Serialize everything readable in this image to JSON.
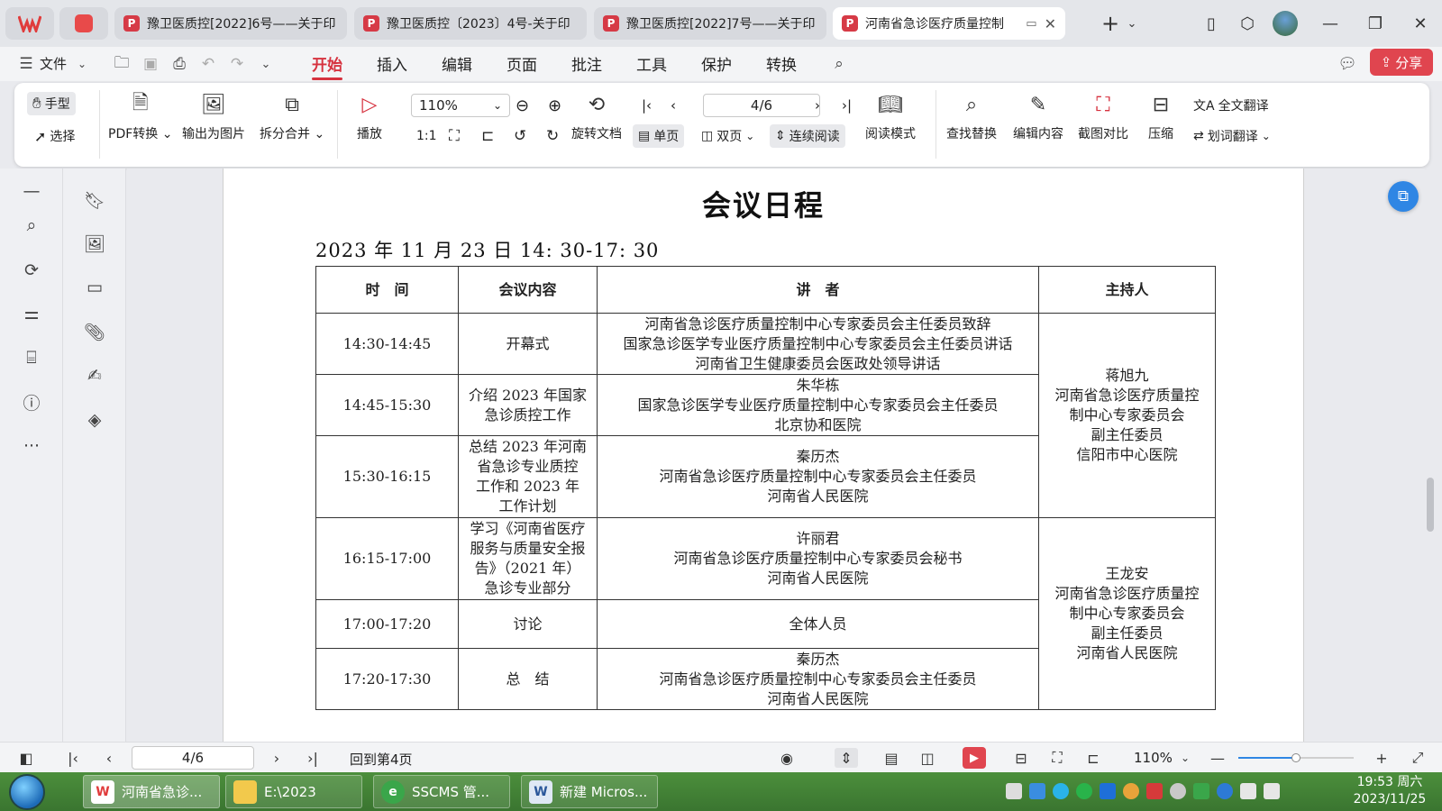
{
  "tabs": [
    {
      "title": "豫卫医质控[2022]6号——关于印"
    },
    {
      "title": "豫卫医质控〔2023〕4号-关于印"
    },
    {
      "title": "豫卫医质控[2022]7号——关于印"
    },
    {
      "title": "河南省急诊医疗质量控制"
    }
  ],
  "menu": {
    "file": "文件",
    "items": [
      "开始",
      "插入",
      "编辑",
      "页面",
      "批注",
      "工具",
      "保护",
      "转换"
    ],
    "share": "分享"
  },
  "ribbon": {
    "hand": "手型",
    "select": "选择",
    "pdf_convert": "PDF转换",
    "export_image": "输出为图片",
    "split_merge": "拆分合并",
    "play": "播放",
    "zoom": "110%",
    "page": "4/6",
    "rotate": "旋转文档",
    "single": "单页",
    "double": "双页",
    "continuous": "连续阅读",
    "reading": "阅读模式",
    "find_replace": "查找替换",
    "edit_content": "编辑内容",
    "screenshot_compare": "截图对比",
    "compress": "压缩",
    "full_translate": "全文翻译",
    "word_translate": "划词翻译"
  },
  "document": {
    "title": "会议日程",
    "date": "2023 年 11 月 23 日 14: 30-17: 30",
    "headers": [
      "时　间",
      "会议内容",
      "讲　者",
      "主持人"
    ],
    "rows": [
      {
        "time": "14:30-14:45",
        "content": [
          "开幕式"
        ],
        "speaker": [
          "河南省急诊医疗质量控制中心专家委员会主任委员致辞",
          "国家急诊医学专业医疗质量控制中心专家委员会主任委员讲话",
          "河南省卫生健康委员会医政处领导讲话"
        ]
      },
      {
        "time": "14:45-15:30",
        "content": [
          "介绍 2023 年国家",
          "急诊质控工作"
        ],
        "speaker": [
          "朱华栋",
          "国家急诊医学专业医疗质量控制中心专家委员会主任委员",
          "北京协和医院"
        ]
      },
      {
        "time": "15:30-16:15",
        "content": [
          "总结 2023 年河南",
          "省急诊专业质控",
          "工作和 2023 年",
          "工作计划"
        ],
        "speaker": [
          "秦历杰",
          "河南省急诊医疗质量控制中心专家委员会主任委员",
          "河南省人民医院"
        ]
      },
      {
        "time": "16:15-17:00",
        "content": [
          "学习《河南省医疗",
          "服务与质量安全报",
          "告》（2021 年）",
          "急诊专业部分"
        ],
        "speaker": [
          "许丽君",
          "河南省急诊医疗质量控制中心专家委员会秘书",
          "河南省人民医院"
        ]
      },
      {
        "time": "17:00-17:20",
        "content": [
          "讨论"
        ],
        "speaker": [
          "全体人员"
        ]
      },
      {
        "time": "17:20-17:30",
        "content": [
          "总　结"
        ],
        "speaker": [
          "秦历杰",
          "河南省急诊医疗质量控制中心专家委员会主任委员",
          "河南省人民医院"
        ]
      }
    ],
    "hosts": [
      {
        "lines": [
          "蒋旭九",
          "河南省急诊医疗质量控",
          "制中心专家委员会",
          "副主任委员",
          "信阳市中心医院"
        ]
      },
      {
        "lines": [
          "王龙安",
          "河南省急诊医疗质量控",
          "制中心专家委员会",
          "副主任委员",
          "河南省人民医院"
        ]
      }
    ]
  },
  "statusbar": {
    "page": "4/6",
    "back_to_page": "回到第4页",
    "zoom": "110%",
    "zoom_level": 0.5
  },
  "taskbar": {
    "items": [
      {
        "label": "河南省急诊..."
      },
      {
        "label": "E:\\2023"
      },
      {
        "label": "SSCMS 管..."
      },
      {
        "label": "新建 Micros..."
      }
    ],
    "time": "19:53 周六",
    "date": "2023/11/25"
  },
  "colors": {
    "accent": "#d6323f",
    "share": "#e0454f",
    "taskbar": "#3f7d33",
    "float": "#2f86e4"
  }
}
